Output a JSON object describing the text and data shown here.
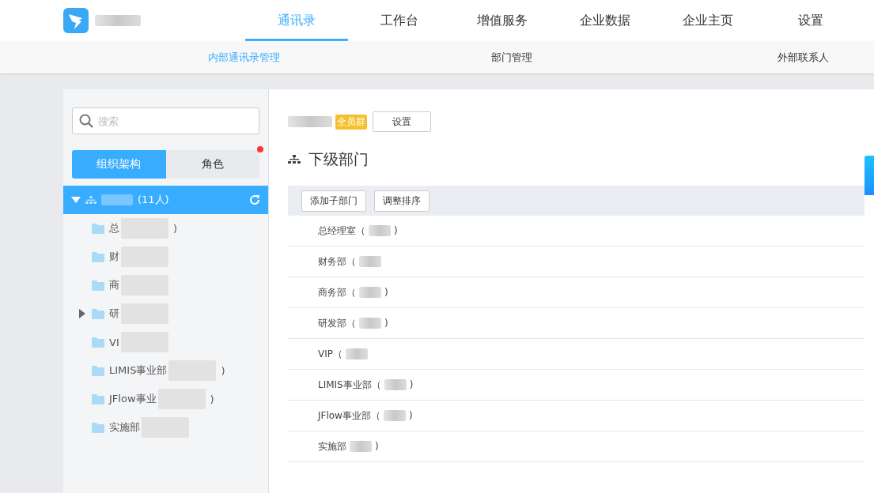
{
  "nav": {
    "items": [
      {
        "label": "通讯录",
        "selected": true
      },
      {
        "label": "工作台",
        "selected": false
      },
      {
        "label": "增值服务",
        "selected": false
      },
      {
        "label": "企业数据",
        "selected": false
      },
      {
        "label": "企业主页",
        "selected": false
      },
      {
        "label": "设置",
        "selected": false
      }
    ]
  },
  "subnav": {
    "items": [
      {
        "label": "内部通讯录管理",
        "selected": true
      },
      {
        "label": "部门管理",
        "selected": false
      },
      {
        "label": "外部联系人",
        "selected": false
      }
    ]
  },
  "sidebar": {
    "search": {
      "placeholder": "搜索"
    },
    "tabs": [
      {
        "label": "组织架构",
        "selected": true,
        "badge": false
      },
      {
        "label": "角色",
        "selected": false,
        "badge": true
      }
    ],
    "tree": {
      "label": "(11人)",
      "expanded": true,
      "selected": true,
      "children": [
        {
          "label": "总",
          "tail": ")",
          "expandable": false
        },
        {
          "label": "财",
          "expandable": false
        },
        {
          "label": "商",
          "expandable": false
        },
        {
          "label": "研",
          "expandable": true
        },
        {
          "label": "VI",
          "expandable": false
        },
        {
          "label": "LIMIS事业部",
          "tail": ")",
          "expandable": false
        },
        {
          "label": "JFlow事业",
          "tail": ")",
          "expandable": false
        },
        {
          "label": "实施部",
          "expandable": false
        }
      ]
    }
  },
  "main": {
    "group_badge": "全员群",
    "settings_button": "设置",
    "section_title": "下级部门",
    "toolbar": [
      "添加子部门",
      "调整排序"
    ],
    "departments": [
      {
        "label": "总经理室（",
        "tail": ")"
      },
      {
        "label": "财务部（"
      },
      {
        "label": "商务部（",
        "tail": ")"
      },
      {
        "label": "研发部（",
        "tail": ")"
      },
      {
        "label": "VIP（"
      },
      {
        "label": "LIMIS事业部（",
        "tail": ")"
      },
      {
        "label": "JFlow事业部（",
        "tail": ")"
      },
      {
        "label": "实施部",
        "tail": ")"
      }
    ]
  }
}
